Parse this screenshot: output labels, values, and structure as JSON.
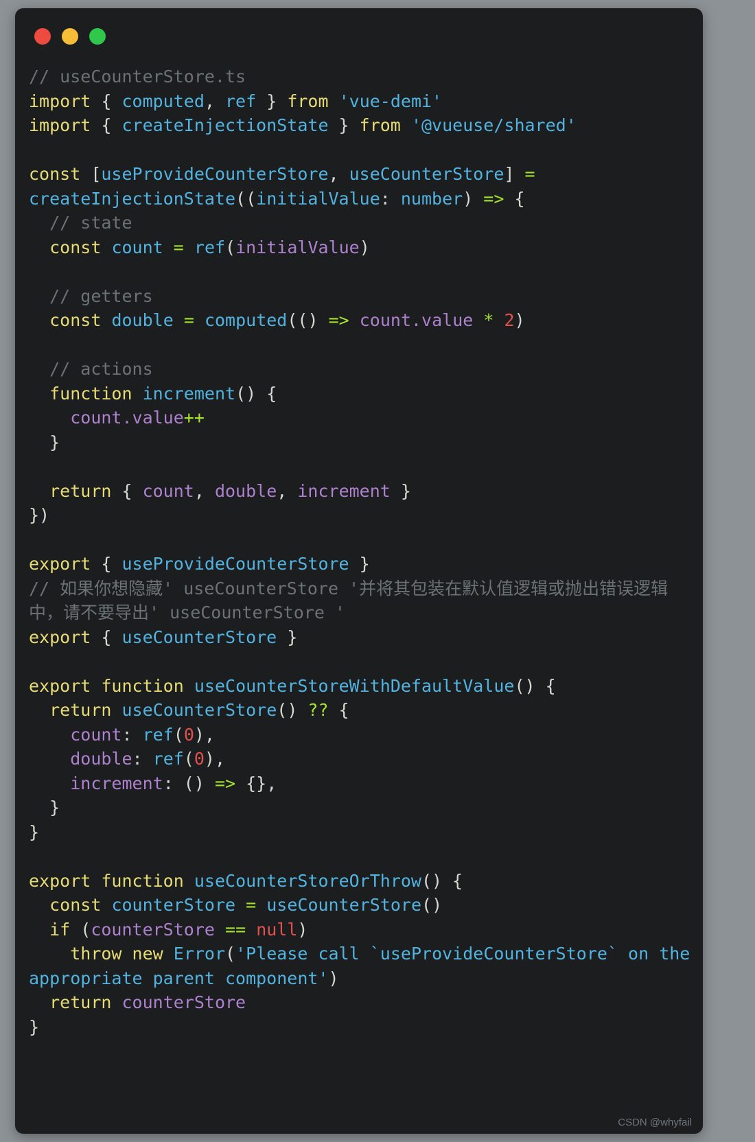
{
  "window": {
    "title": "useCounterStore.ts",
    "traffic_lights": [
      {
        "name": "close",
        "color": "#ee4b40"
      },
      {
        "name": "minimize",
        "color": "#f5bd38"
      },
      {
        "name": "maximize",
        "color": "#2fc84b"
      }
    ],
    "background": "#1b1d1e"
  },
  "watermark": "CSDN @whyfail",
  "code": {
    "language": "typescript",
    "filename": "useCounterStore.ts",
    "lines": [
      [
        {
          "t": "// useCounterStore.ts",
          "c": "cmt"
        }
      ],
      [
        {
          "t": "import",
          "c": "kw"
        },
        {
          "t": " { ",
          "c": "pun"
        },
        {
          "t": "computed",
          "c": "fn"
        },
        {
          "t": ", ",
          "c": "pun"
        },
        {
          "t": "ref",
          "c": "fn"
        },
        {
          "t": " } ",
          "c": "pun"
        },
        {
          "t": "from",
          "c": "kw"
        },
        {
          "t": " ",
          "c": "pun"
        },
        {
          "t": "'vue-demi'",
          "c": "str"
        }
      ],
      [
        {
          "t": "import",
          "c": "kw"
        },
        {
          "t": " { ",
          "c": "pun"
        },
        {
          "t": "createInjectionState",
          "c": "fn"
        },
        {
          "t": " } ",
          "c": "pun"
        },
        {
          "t": "from",
          "c": "kw"
        },
        {
          "t": " ",
          "c": "pun"
        },
        {
          "t": "'@vueuse/shared'",
          "c": "str"
        }
      ],
      [],
      [
        {
          "t": "const",
          "c": "kw"
        },
        {
          "t": " [",
          "c": "pun"
        },
        {
          "t": "useProvideCounterStore",
          "c": "fn"
        },
        {
          "t": ", ",
          "c": "pun"
        },
        {
          "t": "useCounterStore",
          "c": "fn"
        },
        {
          "t": "] ",
          "c": "pun"
        },
        {
          "t": "=",
          "c": "op"
        },
        {
          "t": " ",
          "c": "pun"
        },
        {
          "t": "createInjectionState",
          "c": "fn"
        },
        {
          "t": "((",
          "c": "pun"
        },
        {
          "t": "initialValue",
          "c": "fn"
        },
        {
          "t": ": ",
          "c": "pun"
        },
        {
          "t": "number",
          "c": "fn"
        },
        {
          "t": ") ",
          "c": "pun"
        },
        {
          "t": "=>",
          "c": "op"
        },
        {
          "t": " {",
          "c": "pun"
        }
      ],
      [
        {
          "t": "  ",
          "c": "pun"
        },
        {
          "t": "// state",
          "c": "cmt"
        }
      ],
      [
        {
          "t": "  ",
          "c": "pun"
        },
        {
          "t": "const",
          "c": "kw"
        },
        {
          "t": " ",
          "c": "pun"
        },
        {
          "t": "count",
          "c": "fn"
        },
        {
          "t": " ",
          "c": "pun"
        },
        {
          "t": "=",
          "c": "op"
        },
        {
          "t": " ",
          "c": "pun"
        },
        {
          "t": "ref",
          "c": "fn"
        },
        {
          "t": "(",
          "c": "pun"
        },
        {
          "t": "initialValue",
          "c": "var"
        },
        {
          "t": ")",
          "c": "pun"
        }
      ],
      [],
      [
        {
          "t": "  ",
          "c": "pun"
        },
        {
          "t": "// getters",
          "c": "cmt"
        }
      ],
      [
        {
          "t": "  ",
          "c": "pun"
        },
        {
          "t": "const",
          "c": "kw"
        },
        {
          "t": " ",
          "c": "pun"
        },
        {
          "t": "double",
          "c": "fn"
        },
        {
          "t": " ",
          "c": "pun"
        },
        {
          "t": "=",
          "c": "op"
        },
        {
          "t": " ",
          "c": "pun"
        },
        {
          "t": "computed",
          "c": "fn"
        },
        {
          "t": "(() ",
          "c": "pun"
        },
        {
          "t": "=>",
          "c": "op"
        },
        {
          "t": " ",
          "c": "pun"
        },
        {
          "t": "count.value",
          "c": "var"
        },
        {
          "t": " ",
          "c": "pun"
        },
        {
          "t": "*",
          "c": "op"
        },
        {
          "t": " ",
          "c": "pun"
        },
        {
          "t": "2",
          "c": "num"
        },
        {
          "t": ")",
          "c": "pun"
        }
      ],
      [],
      [
        {
          "t": "  ",
          "c": "pun"
        },
        {
          "t": "// actions",
          "c": "cmt"
        }
      ],
      [
        {
          "t": "  ",
          "c": "pun"
        },
        {
          "t": "function",
          "c": "kw"
        },
        {
          "t": " ",
          "c": "pun"
        },
        {
          "t": "increment",
          "c": "fn"
        },
        {
          "t": "() {",
          "c": "pun"
        }
      ],
      [
        {
          "t": "    ",
          "c": "pun"
        },
        {
          "t": "count.value",
          "c": "var"
        },
        {
          "t": "++",
          "c": "op"
        }
      ],
      [
        {
          "t": "  }",
          "c": "pun"
        }
      ],
      [],
      [
        {
          "t": "  ",
          "c": "pun"
        },
        {
          "t": "return",
          "c": "kw"
        },
        {
          "t": " { ",
          "c": "pun"
        },
        {
          "t": "count",
          "c": "var"
        },
        {
          "t": ", ",
          "c": "pun"
        },
        {
          "t": "double",
          "c": "var"
        },
        {
          "t": ", ",
          "c": "pun"
        },
        {
          "t": "increment",
          "c": "var"
        },
        {
          "t": " }",
          "c": "pun"
        }
      ],
      [
        {
          "t": "})",
          "c": "pun"
        }
      ],
      [],
      [
        {
          "t": "export",
          "c": "kw"
        },
        {
          "t": " { ",
          "c": "pun"
        },
        {
          "t": "useProvideCounterStore",
          "c": "fn"
        },
        {
          "t": " }",
          "c": "pun"
        }
      ],
      [
        {
          "t": "// 如果你想隐藏' useCounterStore '并将其包装在默认值逻辑或抛出错误逻辑中，请不要导出' useCounterStore '",
          "c": "cmt"
        }
      ],
      [
        {
          "t": "export",
          "c": "kw"
        },
        {
          "t": " { ",
          "c": "pun"
        },
        {
          "t": "useCounterStore",
          "c": "fn"
        },
        {
          "t": " }",
          "c": "pun"
        }
      ],
      [],
      [
        {
          "t": "export",
          "c": "kw"
        },
        {
          "t": " ",
          "c": "pun"
        },
        {
          "t": "function",
          "c": "kw"
        },
        {
          "t": " ",
          "c": "pun"
        },
        {
          "t": "useCounterStoreWithDefaultValue",
          "c": "fn"
        },
        {
          "t": "() {",
          "c": "pun"
        }
      ],
      [
        {
          "t": "  ",
          "c": "pun"
        },
        {
          "t": "return",
          "c": "kw"
        },
        {
          "t": " ",
          "c": "pun"
        },
        {
          "t": "useCounterStore",
          "c": "fn"
        },
        {
          "t": "() ",
          "c": "pun"
        },
        {
          "t": "??",
          "c": "op"
        },
        {
          "t": " {",
          "c": "pun"
        }
      ],
      [
        {
          "t": "    ",
          "c": "pun"
        },
        {
          "t": "count",
          "c": "var"
        },
        {
          "t": ": ",
          "c": "pun"
        },
        {
          "t": "ref",
          "c": "fn"
        },
        {
          "t": "(",
          "c": "pun"
        },
        {
          "t": "0",
          "c": "num"
        },
        {
          "t": "),",
          "c": "pun"
        }
      ],
      [
        {
          "t": "    ",
          "c": "pun"
        },
        {
          "t": "double",
          "c": "var"
        },
        {
          "t": ": ",
          "c": "pun"
        },
        {
          "t": "ref",
          "c": "fn"
        },
        {
          "t": "(",
          "c": "pun"
        },
        {
          "t": "0",
          "c": "num"
        },
        {
          "t": "),",
          "c": "pun"
        }
      ],
      [
        {
          "t": "    ",
          "c": "pun"
        },
        {
          "t": "increment",
          "c": "var"
        },
        {
          "t": ": () ",
          "c": "pun"
        },
        {
          "t": "=>",
          "c": "op"
        },
        {
          "t": " {},",
          "c": "pun"
        }
      ],
      [
        {
          "t": "  }",
          "c": "pun"
        }
      ],
      [
        {
          "t": "}",
          "c": "pun"
        }
      ],
      [],
      [
        {
          "t": "export",
          "c": "kw"
        },
        {
          "t": " ",
          "c": "pun"
        },
        {
          "t": "function",
          "c": "kw"
        },
        {
          "t": " ",
          "c": "pun"
        },
        {
          "t": "useCounterStoreOrThrow",
          "c": "fn"
        },
        {
          "t": "() {",
          "c": "pun"
        }
      ],
      [
        {
          "t": "  ",
          "c": "pun"
        },
        {
          "t": "const",
          "c": "kw"
        },
        {
          "t": " ",
          "c": "pun"
        },
        {
          "t": "counterStore",
          "c": "fn"
        },
        {
          "t": " ",
          "c": "pun"
        },
        {
          "t": "=",
          "c": "op"
        },
        {
          "t": " ",
          "c": "pun"
        },
        {
          "t": "useCounterStore",
          "c": "fn"
        },
        {
          "t": "()",
          "c": "pun"
        }
      ],
      [
        {
          "t": "  ",
          "c": "pun"
        },
        {
          "t": "if",
          "c": "kw"
        },
        {
          "t": " (",
          "c": "pun"
        },
        {
          "t": "counterStore",
          "c": "var"
        },
        {
          "t": " ",
          "c": "pun"
        },
        {
          "t": "==",
          "c": "op"
        },
        {
          "t": " ",
          "c": "pun"
        },
        {
          "t": "null",
          "c": "num"
        },
        {
          "t": ")",
          "c": "pun"
        }
      ],
      [
        {
          "t": "    ",
          "c": "pun"
        },
        {
          "t": "throw",
          "c": "kw"
        },
        {
          "t": " ",
          "c": "pun"
        },
        {
          "t": "new",
          "c": "kw"
        },
        {
          "t": " ",
          "c": "pun"
        },
        {
          "t": "Error",
          "c": "fn"
        },
        {
          "t": "(",
          "c": "pun"
        },
        {
          "t": "'Please call `useProvideCounterStore` on the appropriate parent component'",
          "c": "str"
        },
        {
          "t": ")",
          "c": "pun"
        }
      ],
      [
        {
          "t": "  ",
          "c": "pun"
        },
        {
          "t": "return",
          "c": "kw"
        },
        {
          "t": " ",
          "c": "pun"
        },
        {
          "t": "counterStore",
          "c": "var"
        }
      ],
      [
        {
          "t": "}",
          "c": "pun"
        }
      ]
    ]
  }
}
